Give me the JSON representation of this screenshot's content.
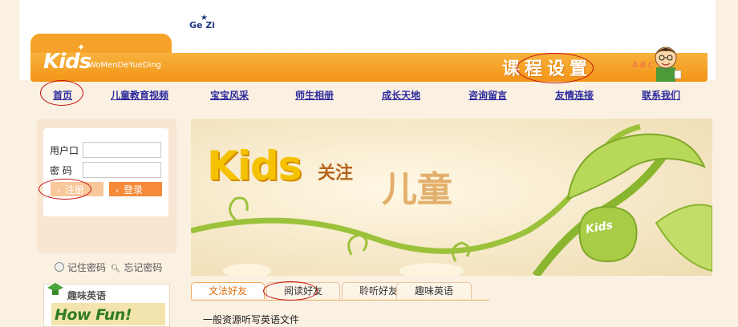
{
  "site": {
    "partner_logo": "Ge Zi",
    "logo_text": "Kids",
    "logo_subtitle": "WoMenDeYueDing",
    "course_heading": "课程设置",
    "abc_text": "A B C"
  },
  "nav": {
    "items": [
      {
        "label": "首页"
      },
      {
        "label": "儿童教育视频"
      },
      {
        "label": "宝宝风采"
      },
      {
        "label": "师生相册"
      },
      {
        "label": "成长天地"
      },
      {
        "label": "咨询留言"
      },
      {
        "label": "友情连接"
      },
      {
        "label": "联系我们"
      }
    ]
  },
  "login": {
    "username_label": "用户口",
    "password_label": "密 码",
    "username_value": "",
    "password_value": "",
    "register_label": "注册",
    "login_label": "登录",
    "remember_label": "记住密码",
    "forgot_label": "忘记密码"
  },
  "english": {
    "heading": "趣味英语",
    "promo": "How Fun! English"
  },
  "hero": {
    "kids": "Kids",
    "focus": "关注",
    "child": "儿童",
    "leaf_text": "Kids"
  },
  "tabs": [
    {
      "label": "文法好友",
      "active": true
    },
    {
      "label": "阅读好友",
      "active": false
    },
    {
      "label": "聆听好友",
      "active": false
    },
    {
      "label": "趣味英语",
      "active": false
    }
  ],
  "content": {
    "first_item": "一般资源听写英语文件"
  },
  "colors": {
    "banner_orange": "#f39416",
    "nav_link": "#2c2a9e",
    "annotation_red": "#c41010",
    "active_tab": "#e07010"
  }
}
